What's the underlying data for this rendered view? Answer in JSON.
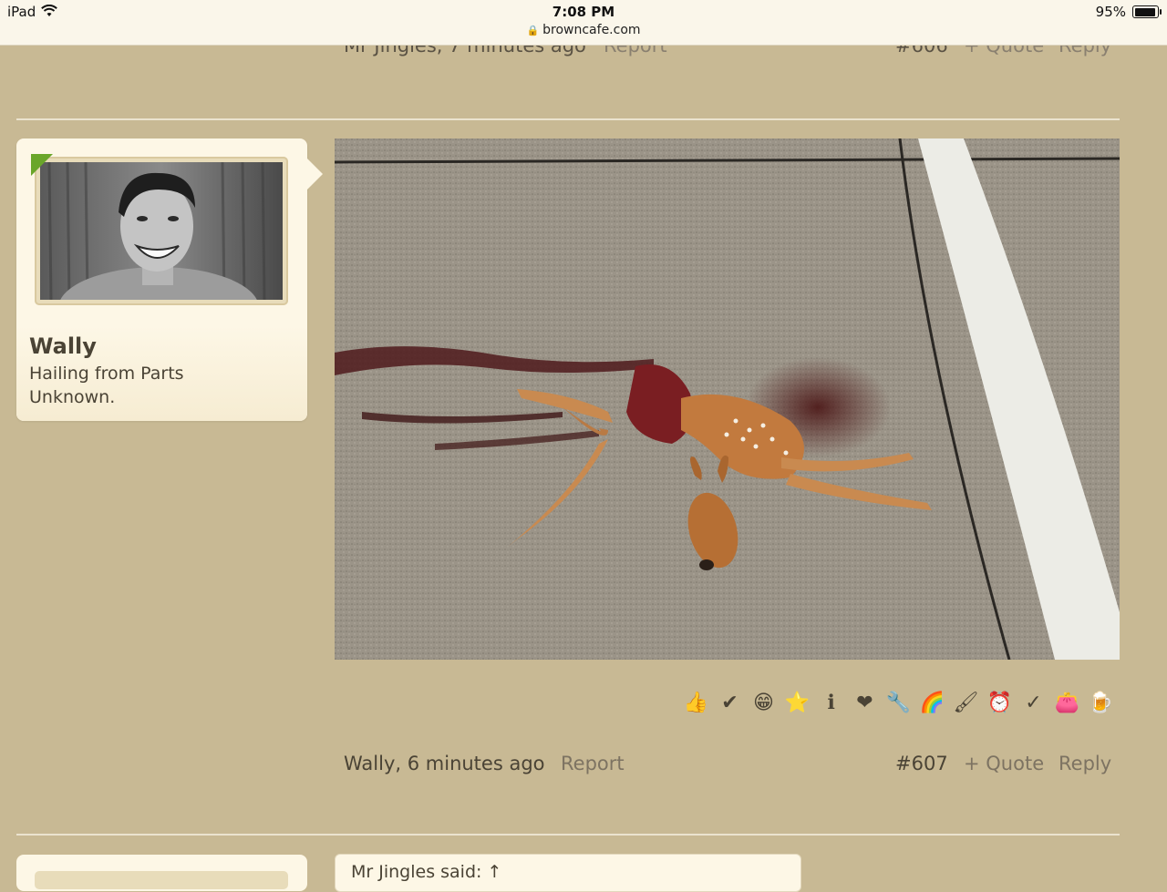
{
  "status_bar": {
    "device": "iPad",
    "time": "7:08 PM",
    "url": "browncafe.com",
    "battery_pct": "95%",
    "battery_level": 0.95
  },
  "prev_post": {
    "author_time": "Mr Jingles, 7 minutes ago",
    "report": "Report",
    "number": "#606",
    "quote": "+ Quote",
    "reply": "Reply"
  },
  "post": {
    "username": "Wally",
    "user_title": "Hailing from Parts Unknown.",
    "author_time": "Wally, 6 minutes ago",
    "report": "Report",
    "number": "#607",
    "quote": "+ Quote",
    "reply": "Reply",
    "reactions": [
      {
        "icon": "thumbs-up-icon",
        "glyph": "👍"
      },
      {
        "icon": "checkmark-icon",
        "glyph": "✔"
      },
      {
        "icon": "smiley-icon",
        "glyph": "😁"
      },
      {
        "icon": "award-star-icon",
        "glyph": "⭐"
      },
      {
        "icon": "info-icon",
        "glyph": "ℹ"
      },
      {
        "icon": "heart-icon",
        "glyph": "❤"
      },
      {
        "icon": "wrench-icon",
        "glyph": "🔧"
      },
      {
        "icon": "rainbow-icon",
        "glyph": "🌈"
      },
      {
        "icon": "paintbrush-icon",
        "glyph": "🖌"
      },
      {
        "icon": "alarm-clock-icon",
        "glyph": "⏰"
      },
      {
        "icon": "spellcheck-icon",
        "glyph": "✓"
      },
      {
        "icon": "wallet-icon",
        "glyph": "👛"
      },
      {
        "icon": "beer-mug-icon",
        "glyph": "🍺"
      }
    ]
  },
  "next_post": {
    "quote_header": "Mr Jingles said: ↑"
  },
  "colors": {
    "page_bg": "#c8b994",
    "card_bg": "#fdf7e6",
    "online": "#6aa62a"
  }
}
